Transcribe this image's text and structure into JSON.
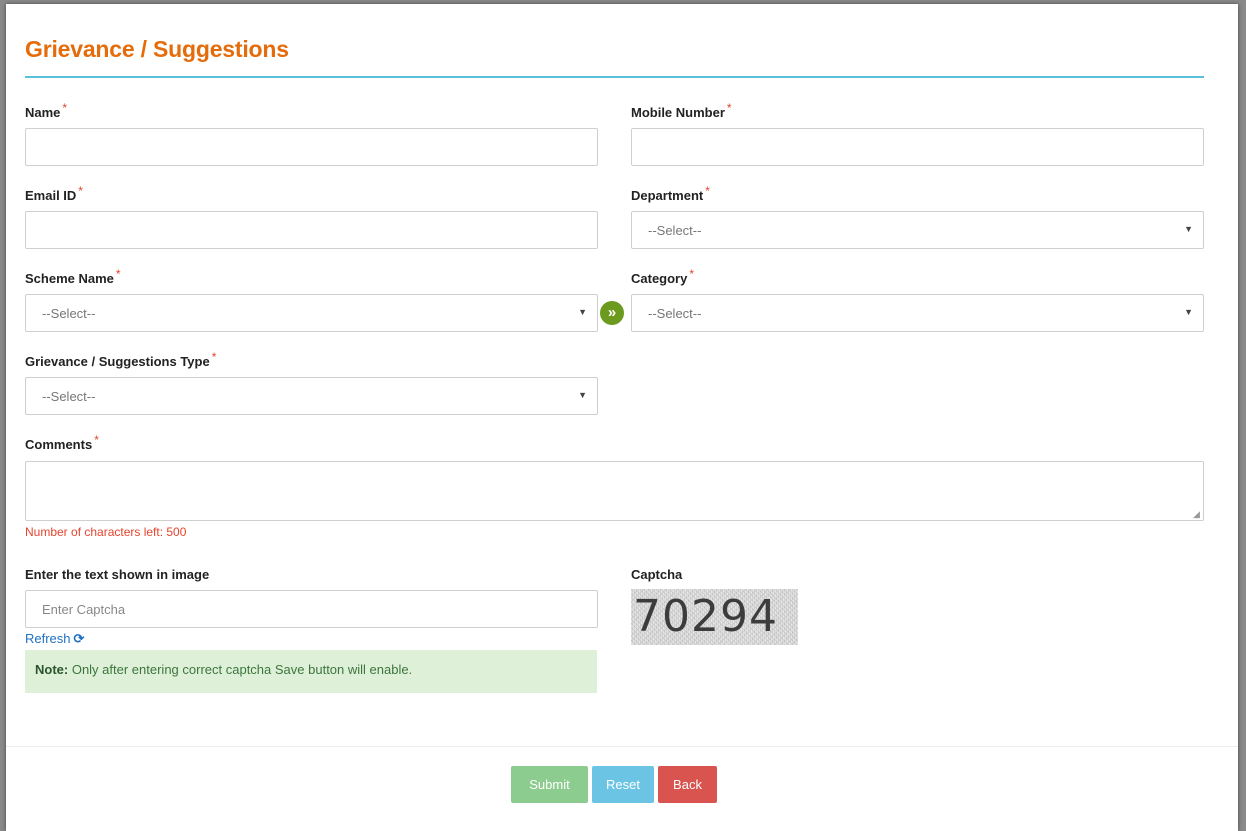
{
  "page": {
    "title": "Grievance / Suggestions",
    "accent_color": "#e46c0a",
    "rule_color": "#5bc0de"
  },
  "form": {
    "required_marker": "*",
    "name": {
      "label": "Name",
      "value": ""
    },
    "mobile": {
      "label": "Mobile Number",
      "value": ""
    },
    "email": {
      "label": "Email ID",
      "value": ""
    },
    "department": {
      "label": "Department",
      "selected": "--Select--"
    },
    "scheme": {
      "label": "Scheme Name",
      "selected": "--Select--"
    },
    "category": {
      "label": "Category",
      "selected": "--Select--"
    },
    "grievance_type": {
      "label": "Grievance / Suggestions Type",
      "selected": "--Select--"
    },
    "comments": {
      "label": "Comments",
      "value": "",
      "counter_text": "Number of characters left: 500"
    },
    "captcha_input": {
      "label": "Enter the text shown in image",
      "placeholder": "Enter Captcha"
    },
    "captcha_image": {
      "label": "Captcha",
      "text": "70294"
    },
    "refresh_label": "Refresh",
    "note": {
      "prefix": "Note:",
      "text": " Only after entering correct captcha Save button will enable."
    }
  },
  "buttons": {
    "submit": "Submit",
    "reset": "Reset",
    "back": "Back"
  },
  "icons": {
    "go": "double-chevron-right-icon",
    "refresh": "refresh-icon",
    "caret": "caret-down-icon"
  }
}
